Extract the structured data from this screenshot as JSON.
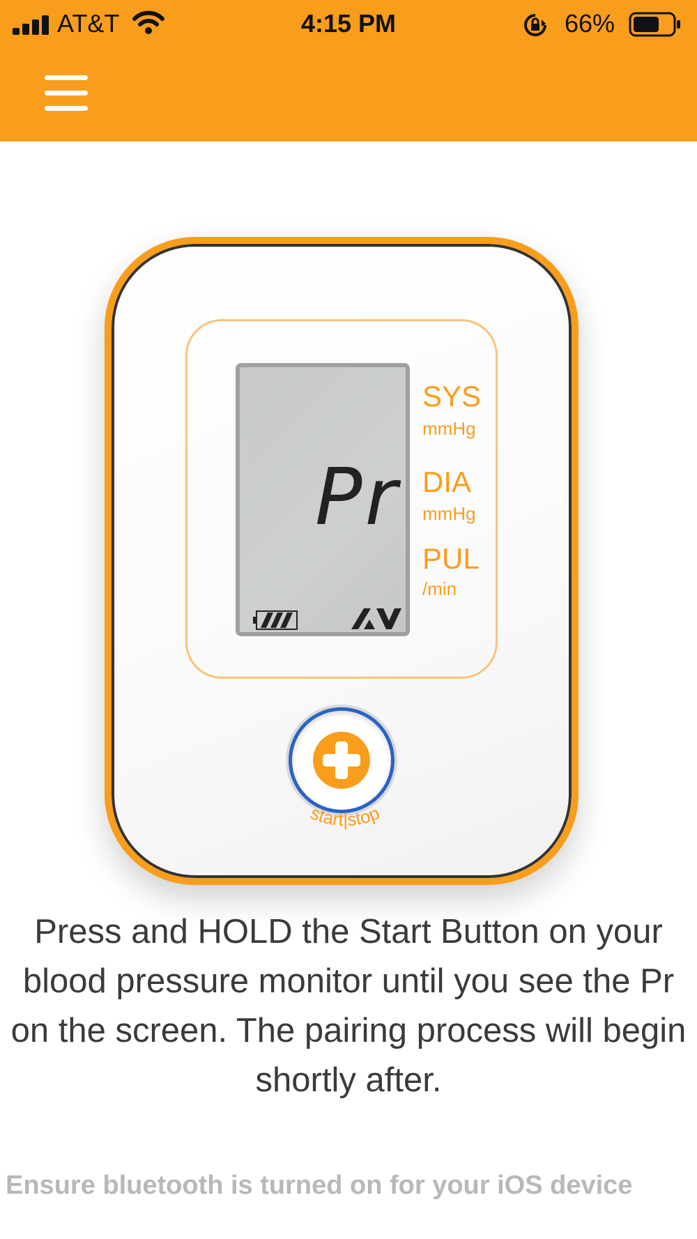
{
  "status_bar": {
    "carrier": "AT&T",
    "time": "4:15 PM",
    "battery_percent": "66%",
    "battery_level": 0.66,
    "signal_icon": "cellular-signal-icon",
    "wifi_icon": "wifi-icon",
    "rotation_lock_icon": "rotation-lock-icon"
  },
  "header": {
    "background_color": "#f99d1c",
    "menu_icon": "hamburger-menu-icon"
  },
  "device": {
    "lcd_display": "Pr",
    "labels": {
      "sys": "SYS",
      "sys_unit": "mmHg",
      "dia": "DIA",
      "dia_unit": "mmHg",
      "pul": "PUL",
      "pul_unit": "/min"
    },
    "start_stop_label": "start|stop",
    "accent_color": "#f99d1c",
    "button_ring_color": "#2a62c6"
  },
  "instruction": "Press and HOLD the Start Button on your blood pressure monitor until you see the Pr on the screen. The pairing process will begin shortly after.",
  "footnote": "Ensure bluetooth is turned on for your iOS device"
}
